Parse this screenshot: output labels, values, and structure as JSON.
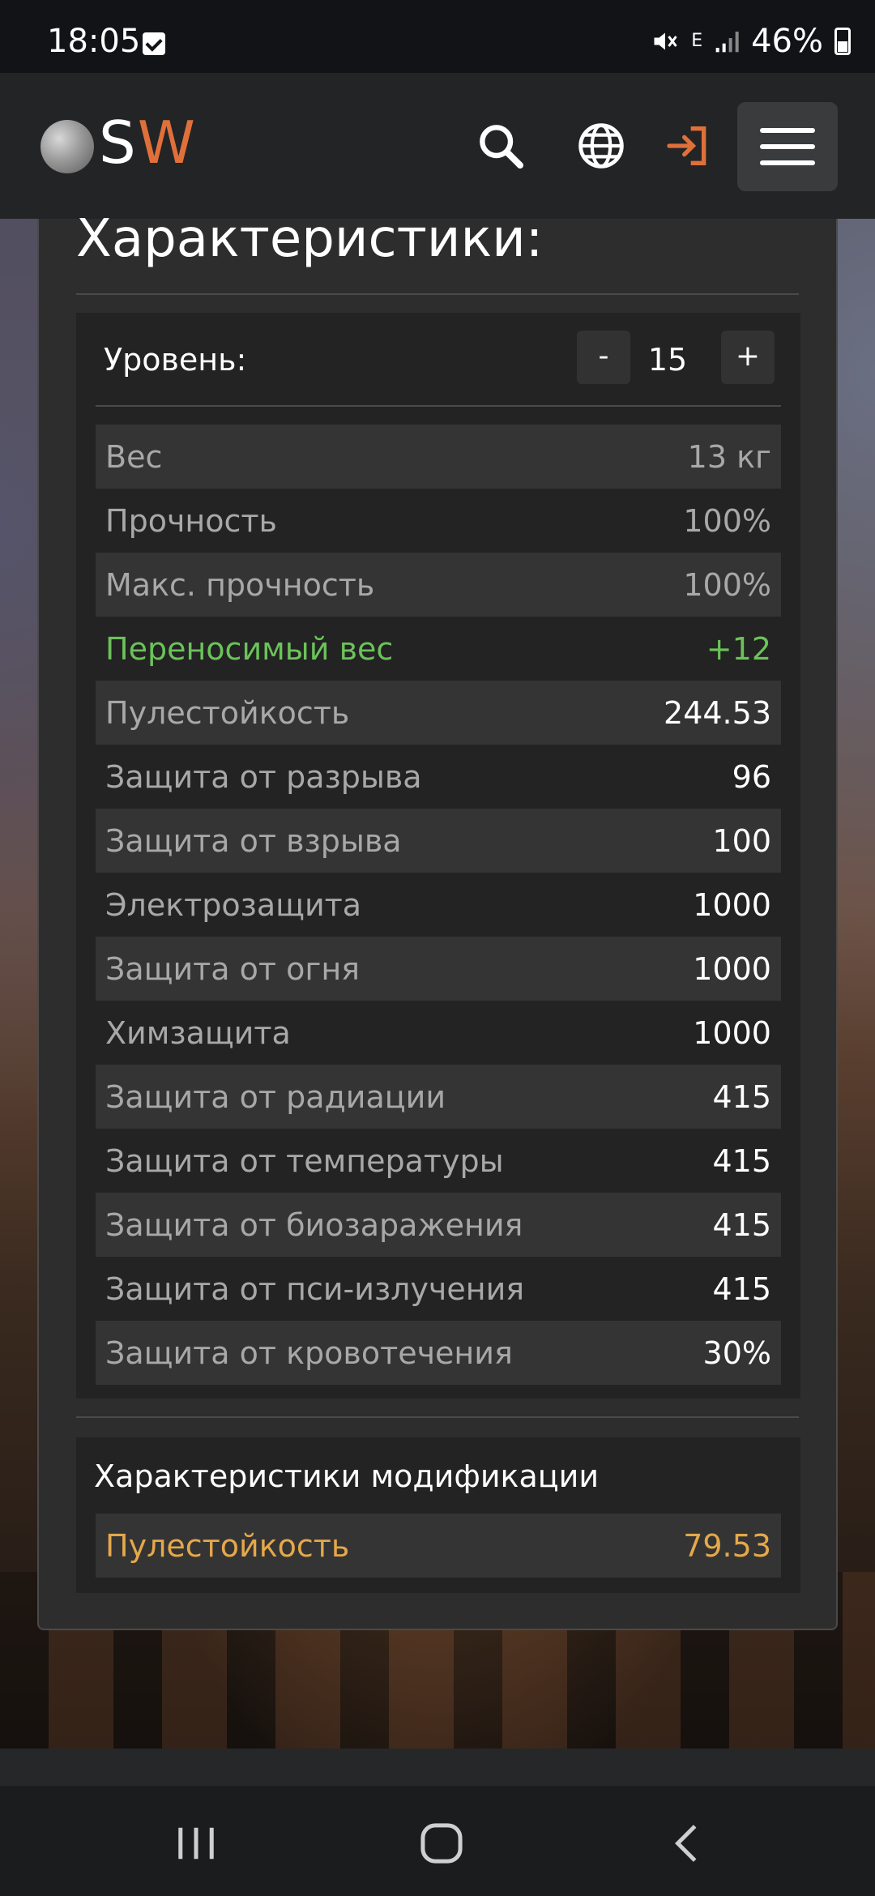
{
  "status_bar": {
    "time": "18:05",
    "network": "E",
    "battery": "46%"
  },
  "header": {
    "logo_s": "S",
    "logo_w": "W",
    "accent_color": "#e0703a"
  },
  "card": {
    "title": "Характеристики:"
  },
  "level": {
    "label": "Уровень:",
    "minus": "-",
    "value": "15",
    "plus": "+"
  },
  "stats": [
    {
      "label": "Вес",
      "value": "13 кг"
    },
    {
      "label": "Прочность",
      "value": "100%"
    },
    {
      "label": "Макс. прочность",
      "value": "100%"
    },
    {
      "label": "Переносимый вес",
      "value": "+12"
    },
    {
      "label": "Пулестойкость",
      "value": "244.53"
    },
    {
      "label": "Защита от разрыва",
      "value": "96"
    },
    {
      "label": "Защита от взрыва",
      "value": "100"
    },
    {
      "label": "Электрозащита",
      "value": "1000"
    },
    {
      "label": "Защита от огня",
      "value": "1000"
    },
    {
      "label": "Химзащита",
      "value": "1000"
    },
    {
      "label": "Защита от радиации",
      "value": "415"
    },
    {
      "label": "Защита от температуры",
      "value": "415"
    },
    {
      "label": "Защита от биозаражения",
      "value": "415"
    },
    {
      "label": "Защита от пси-излучения",
      "value": "415"
    },
    {
      "label": "Защита от кровотечения",
      "value": "30%"
    }
  ],
  "modification": {
    "title": "Характеристики модификации",
    "label": "Пулестойкость",
    "value": "79.53",
    "color": "#e5a84a"
  },
  "icons": {
    "search": "search-icon",
    "language": "globe-icon",
    "login": "login-icon",
    "menu": "hamburger-icon"
  }
}
